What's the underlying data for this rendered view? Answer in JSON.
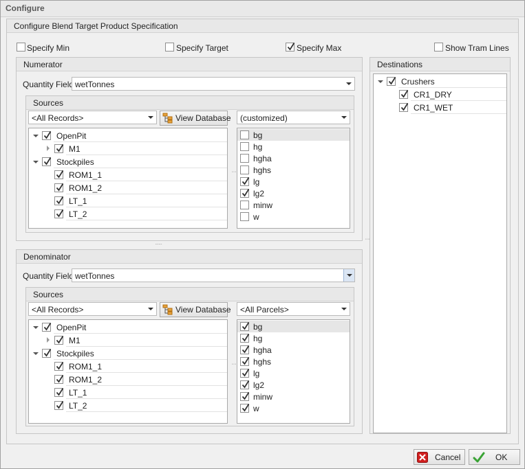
{
  "window": {
    "title": "Configure"
  },
  "group_title": "Configure Blend Target Product Specification",
  "options": {
    "specify_min": {
      "label": "Specify Min",
      "checked": false
    },
    "specify_target": {
      "label": "Specify Target",
      "checked": false
    },
    "specify_max": {
      "label": "Specify Max",
      "checked": true
    },
    "show_tram_lines": {
      "label": "Show Tram Lines",
      "checked": false
    }
  },
  "numerator": {
    "title": "Numerator",
    "quantity_label": "Quantity Field",
    "quantity_value": "wetTonnes",
    "sources_title": "Sources",
    "records_value": "<All Records>",
    "view_db_label": "View Database",
    "parcel_value": "(customized)",
    "tree": [
      {
        "label": "OpenPit",
        "level": 0,
        "expander": "down",
        "checked": true
      },
      {
        "label": "M1",
        "level": 1,
        "expander": "right",
        "checked": true
      },
      {
        "label": "Stockpiles",
        "level": 0,
        "expander": "down",
        "checked": true
      },
      {
        "label": "ROM1_1",
        "level": 1,
        "expander": "none",
        "checked": true
      },
      {
        "label": "ROM1_2",
        "level": 1,
        "expander": "none",
        "checked": true
      },
      {
        "label": "LT_1",
        "level": 1,
        "expander": "none",
        "checked": true
      },
      {
        "label": "LT_2",
        "level": 1,
        "expander": "none",
        "checked": true
      }
    ],
    "parcels": [
      {
        "label": "bg",
        "checked": false
      },
      {
        "label": "hg",
        "checked": false
      },
      {
        "label": "hgha",
        "checked": false
      },
      {
        "label": "hghs",
        "checked": false
      },
      {
        "label": "lg",
        "checked": true
      },
      {
        "label": "lg2",
        "checked": true
      },
      {
        "label": "minw",
        "checked": false
      },
      {
        "label": "w",
        "checked": false
      }
    ]
  },
  "denominator": {
    "title": "Denominator",
    "quantity_label": "Quantity Field",
    "quantity_value": "wetTonnes",
    "sources_title": "Sources",
    "records_value": "<All Records>",
    "view_db_label": "View Database",
    "parcel_value": "<All Parcels>",
    "tree": [
      {
        "label": "OpenPit",
        "level": 0,
        "expander": "down",
        "checked": true
      },
      {
        "label": "M1",
        "level": 1,
        "expander": "right",
        "checked": true
      },
      {
        "label": "Stockpiles",
        "level": 0,
        "expander": "down",
        "checked": true
      },
      {
        "label": "ROM1_1",
        "level": 1,
        "expander": "none",
        "checked": true
      },
      {
        "label": "ROM1_2",
        "level": 1,
        "expander": "none",
        "checked": true
      },
      {
        "label": "LT_1",
        "level": 1,
        "expander": "none",
        "checked": true
      },
      {
        "label": "LT_2",
        "level": 1,
        "expander": "none",
        "checked": true
      }
    ],
    "parcels": [
      {
        "label": "bg",
        "checked": true
      },
      {
        "label": "hg",
        "checked": true
      },
      {
        "label": "hgha",
        "checked": true
      },
      {
        "label": "hghs",
        "checked": true
      },
      {
        "label": "lg",
        "checked": true
      },
      {
        "label": "lg2",
        "checked": true
      },
      {
        "label": "minw",
        "checked": true
      },
      {
        "label": "w",
        "checked": true
      }
    ]
  },
  "destinations": {
    "title": "Destinations",
    "tree": [
      {
        "label": "Crushers",
        "level": 0,
        "expander": "down",
        "checked": true
      },
      {
        "label": "CR1_DRY",
        "level": 1,
        "expander": "none",
        "checked": true
      },
      {
        "label": "CR1_WET",
        "level": 1,
        "expander": "none",
        "checked": true
      }
    ]
  },
  "footer": {
    "cancel_label": "Cancel",
    "ok_label": "OK"
  },
  "colors": {
    "check_mark": "#333333",
    "cancel_icon": "#d11f1f",
    "ok_icon": "#3aa335",
    "db_icon": "#e8a23a"
  }
}
